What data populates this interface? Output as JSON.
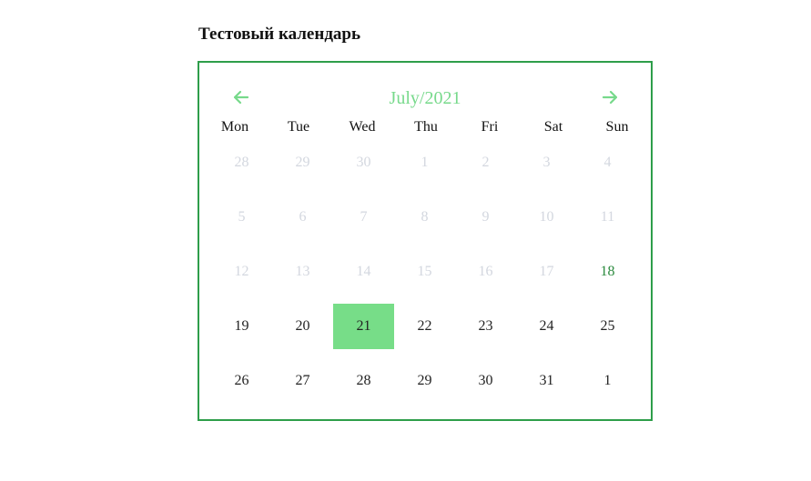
{
  "page": {
    "title": "Тестовый календарь"
  },
  "calendar": {
    "month_label": "July/2021",
    "prev_icon": "arrow-left-icon",
    "next_icon": "arrow-right-icon",
    "colors": {
      "border": "#2e9e4a",
      "accent": "#77d98b",
      "selected_bg": "#77dd88",
      "disabled_text": "#d3d7df",
      "today_text": "#2b8a3e"
    },
    "weekdays": [
      "Mon",
      "Tue",
      "Wed",
      "Thu",
      "Fri",
      "Sat",
      "Sun"
    ],
    "days": [
      {
        "label": "28",
        "state": "disabled"
      },
      {
        "label": "29",
        "state": "disabled"
      },
      {
        "label": "30",
        "state": "disabled"
      },
      {
        "label": "1",
        "state": "disabled"
      },
      {
        "label": "2",
        "state": "disabled"
      },
      {
        "label": "3",
        "state": "disabled"
      },
      {
        "label": "4",
        "state": "disabled"
      },
      {
        "label": "5",
        "state": "disabled"
      },
      {
        "label": "6",
        "state": "disabled"
      },
      {
        "label": "7",
        "state": "disabled"
      },
      {
        "label": "8",
        "state": "disabled"
      },
      {
        "label": "9",
        "state": "disabled"
      },
      {
        "label": "10",
        "state": "disabled"
      },
      {
        "label": "11",
        "state": "disabled"
      },
      {
        "label": "12",
        "state": "disabled"
      },
      {
        "label": "13",
        "state": "disabled"
      },
      {
        "label": "14",
        "state": "disabled"
      },
      {
        "label": "15",
        "state": "disabled"
      },
      {
        "label": "16",
        "state": "disabled"
      },
      {
        "label": "17",
        "state": "disabled"
      },
      {
        "label": "18",
        "state": "today"
      },
      {
        "label": "19",
        "state": "normal"
      },
      {
        "label": "20",
        "state": "normal"
      },
      {
        "label": "21",
        "state": "selected"
      },
      {
        "label": "22",
        "state": "normal"
      },
      {
        "label": "23",
        "state": "normal"
      },
      {
        "label": "24",
        "state": "normal"
      },
      {
        "label": "25",
        "state": "normal"
      },
      {
        "label": "26",
        "state": "normal"
      },
      {
        "label": "27",
        "state": "normal"
      },
      {
        "label": "28",
        "state": "normal"
      },
      {
        "label": "29",
        "state": "normal"
      },
      {
        "label": "30",
        "state": "normal"
      },
      {
        "label": "31",
        "state": "normal"
      },
      {
        "label": "1",
        "state": "normal"
      }
    ]
  }
}
